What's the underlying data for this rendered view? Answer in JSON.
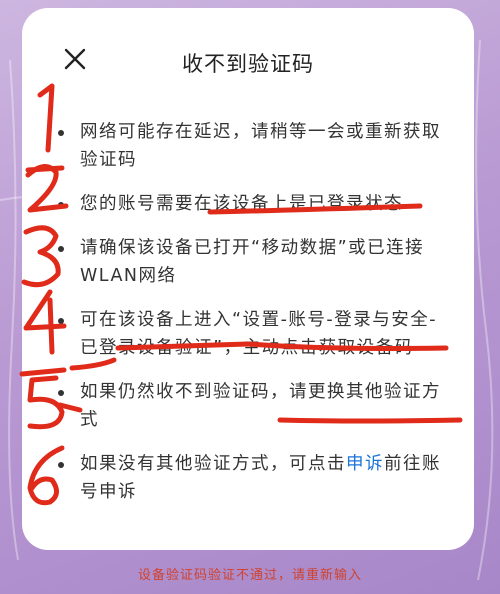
{
  "dialog": {
    "title": "收不到验证码",
    "close_icon": "close-icon",
    "items": [
      {
        "text": "网络可能存在延迟，请稍等一会或重新获取验证码"
      },
      {
        "text": "您的账号需要在该设备上是已登录状态"
      },
      {
        "text": "请确保该设备已打开“移动数据”或已连接WLAN网络"
      },
      {
        "text": "可在该设备上进入“设置-账号-登录与安全-已登录设备验证”，主动点击获取设备码"
      },
      {
        "text": "如果仍然收不到验证码，请更换其他验证方式"
      },
      {
        "text_before": "如果没有其他验证方式，可点击",
        "link": "申诉",
        "text_after": "前往账号申诉"
      }
    ]
  },
  "footer": {
    "message": "设备验证码验证不通过，请重新输入"
  },
  "colors": {
    "annotation": "#e02a1a",
    "link": "#1a73d9",
    "footer": "#d0422d"
  }
}
